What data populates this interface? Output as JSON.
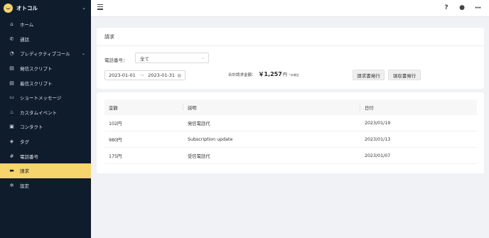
{
  "app": {
    "name": "オトコル"
  },
  "sidebar": {
    "items": [
      {
        "label": "ホーム",
        "icon": "home-icon",
        "glyph": "⌂"
      },
      {
        "label": "通話",
        "icon": "phone-icon",
        "glyph": "✆"
      },
      {
        "label": "プレディクティブコール",
        "icon": "predictive-call-icon",
        "glyph": "◔",
        "has_children": true
      },
      {
        "label": "発信スクリプト",
        "icon": "outbound-script-icon",
        "glyph": "▤"
      },
      {
        "label": "着信スクリプト",
        "icon": "inbound-script-icon",
        "glyph": "▤"
      },
      {
        "label": "ショートメッセージ",
        "icon": "sms-icon",
        "glyph": "▭"
      },
      {
        "label": "カスタムイベント",
        "icon": "flame-icon",
        "glyph": "♨"
      },
      {
        "label": "コンタクト",
        "icon": "contact-card-icon",
        "glyph": "▣"
      },
      {
        "label": "タグ",
        "icon": "tag-icon",
        "glyph": "◈"
      },
      {
        "label": "電話番号",
        "icon": "hash-icon",
        "glyph": "#"
      },
      {
        "label": "請求",
        "icon": "credit-card-icon",
        "glyph": "▬",
        "active": true
      },
      {
        "label": "設定",
        "icon": "gear-icon",
        "glyph": "✲"
      }
    ],
    "active_color": "#f6d46e",
    "bg_color": "#0f1c2c"
  },
  "topbar": {
    "help_glyph": "?",
    "user_glyph": "●",
    "more_glyph": "•••"
  },
  "billing": {
    "title": "請求",
    "phone_label": "電話番号：",
    "phone_value": "全て",
    "date_from": "2023-01-01",
    "date_to": "2023-01-31",
    "total_label": "合計請求金額：",
    "total_amount": "￥1,257",
    "total_unit": "円",
    "total_note": "*未確定",
    "btn_invoice": "請求書発行",
    "btn_receipt": "領収書発行"
  },
  "table": {
    "headers": [
      "金額",
      "説明",
      "日付"
    ],
    "rows": [
      [
        "102円",
        "発信電話代",
        "2023/01/19"
      ],
      [
        "980円",
        "Subscription update",
        "2023/01/13"
      ],
      [
        "175円",
        "受信電話代",
        "2023/01/07"
      ]
    ]
  }
}
